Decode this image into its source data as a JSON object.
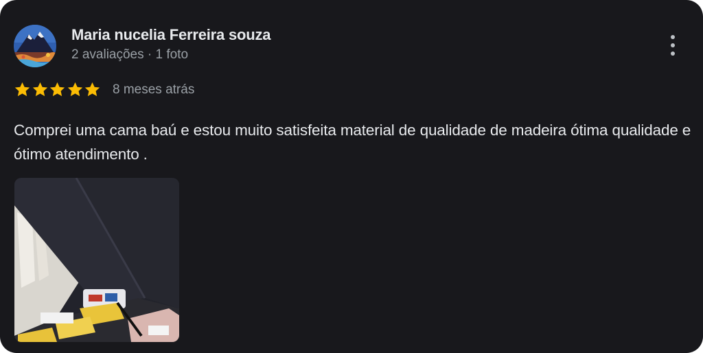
{
  "review": {
    "author": {
      "name": "Maria nucelia Ferreira souza",
      "meta": "2 avaliações · 1 foto",
      "avatar_icon": "mountain-landscape-avatar"
    },
    "rating": {
      "stars": 5,
      "max": 5,
      "star_color": "#fbbc04"
    },
    "time_ago": "8 meses atrás",
    "text": "Comprei uma cama baú e estou muito satisfeita material de qualidade de madeira ótima qualidade e ótimo atendimento .",
    "photos": [
      {
        "icon": "bed-storage-photo"
      }
    ],
    "menu_icon": "more-vert-icon"
  },
  "colors": {
    "card_background": "#18181c",
    "primary_text": "#e8eaed",
    "secondary_text": "#9aa0a6"
  }
}
